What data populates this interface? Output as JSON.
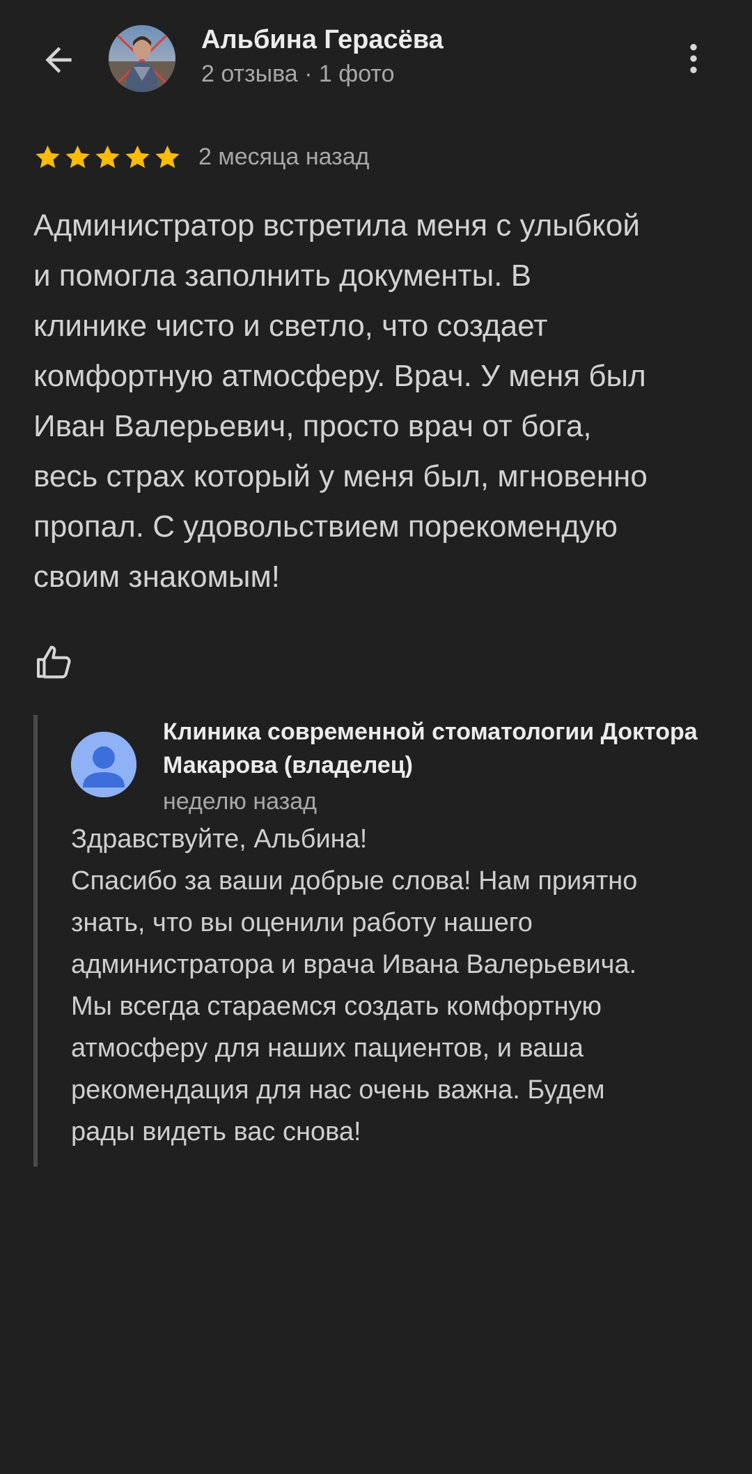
{
  "header": {
    "author_name": "Альбина Герасёва",
    "author_meta": "2 отзыва · 1 фото",
    "icons": {
      "back": "arrow-back-icon",
      "more": "more-vert-icon"
    }
  },
  "review": {
    "rating": 5,
    "rating_max": 5,
    "star_color": "#fbbc04",
    "date": "2 месяца назад",
    "text": "Администратор встретила меня с улыбкой\nи помогла заполнить документы. В\nклинике чисто и светло, что создает\nкомфортную атмосферу. Врач. У меня был\nИван Валерьевич, просто врач от бога,\nвесь страх который у меня был, мгновенно\nпропал. С удовольствием порекомендую\nсвоим знакомым!",
    "like_icon": "thumb-up-outline-icon"
  },
  "owner_reply": {
    "name": "Клиника современной стоматологии Доктора Макарова (владелец)",
    "date": "неделю назад",
    "text": "Здравствуйте, Альбина!\nСпасибо за ваши добрые слова! Нам приятно\nзнать, что вы оценили работу нашего\nадминистратора и врача Ивана Валерьевича.\nМы всегда стараемся создать комфортную\nатмосферу для наших пациентов, и ваша\nрекомендация для нас очень важна. Будем\nрады видеть вас снова!",
    "avatar_color": "#8fb2f7"
  },
  "colors": {
    "background": "#202020",
    "primary_text": "#ececec",
    "secondary_text": "#a8a8a8"
  }
}
